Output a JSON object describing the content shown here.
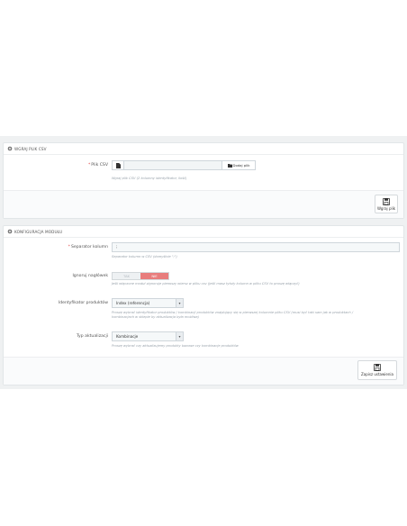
{
  "import_panel": {
    "title": "WGRAJ PLIK CSV",
    "file_label": "Plik CSV",
    "file_button": "Dodaj plik",
    "file_help": "Wgraj plik CSV (2 kolumny identyfikator, ilość)",
    "save_label": "Wgraj plik"
  },
  "config_panel": {
    "title": "KONFIGURACJA MODUŁU",
    "separator_label": "Separator kolumn",
    "separator_value": ";",
    "separator_help": "Separator kolumn w CSV (domyślnie \";\")",
    "ignore_label": "Ignoruj nagłówek",
    "ignore_yes": "TAK",
    "ignore_no": "NIE",
    "ignore_help": "Jeśli włączone moduł zignoruje pierwszy wiersz w pliku csv (jeśli masz tytuły kolumn w pliku CSV to proszę włączyć)",
    "identifier_label": "Identyfikator produktów",
    "identifier_value": "Index (referencja)",
    "identifier_help": "Proszę wybrać identyfikator produktów / kombinacji produktów znajdujący się w pierwszej kolumnie pliku CSV (musi być taki sam jak w produktach / kombinacjach w sklepie by aktualizacja była możliwa)",
    "update_label": "Typ aktualizacji",
    "update_value": "Kombinacje",
    "update_help": "Proszę wybrać czy aktualizujemy produkty bazowe czy kombinacje produktów",
    "save_label": "Zapisz ustawienia"
  },
  "icons": {
    "heading": "gear-icon",
    "file": "file-icon",
    "folder": "folder-icon",
    "save": "floppy-disk-icon",
    "dropdown": "chevron-down-icon"
  },
  "colors": {
    "toggle_active": "#e87d7d",
    "required": "#e34b4b",
    "background": "#eff1f2"
  }
}
